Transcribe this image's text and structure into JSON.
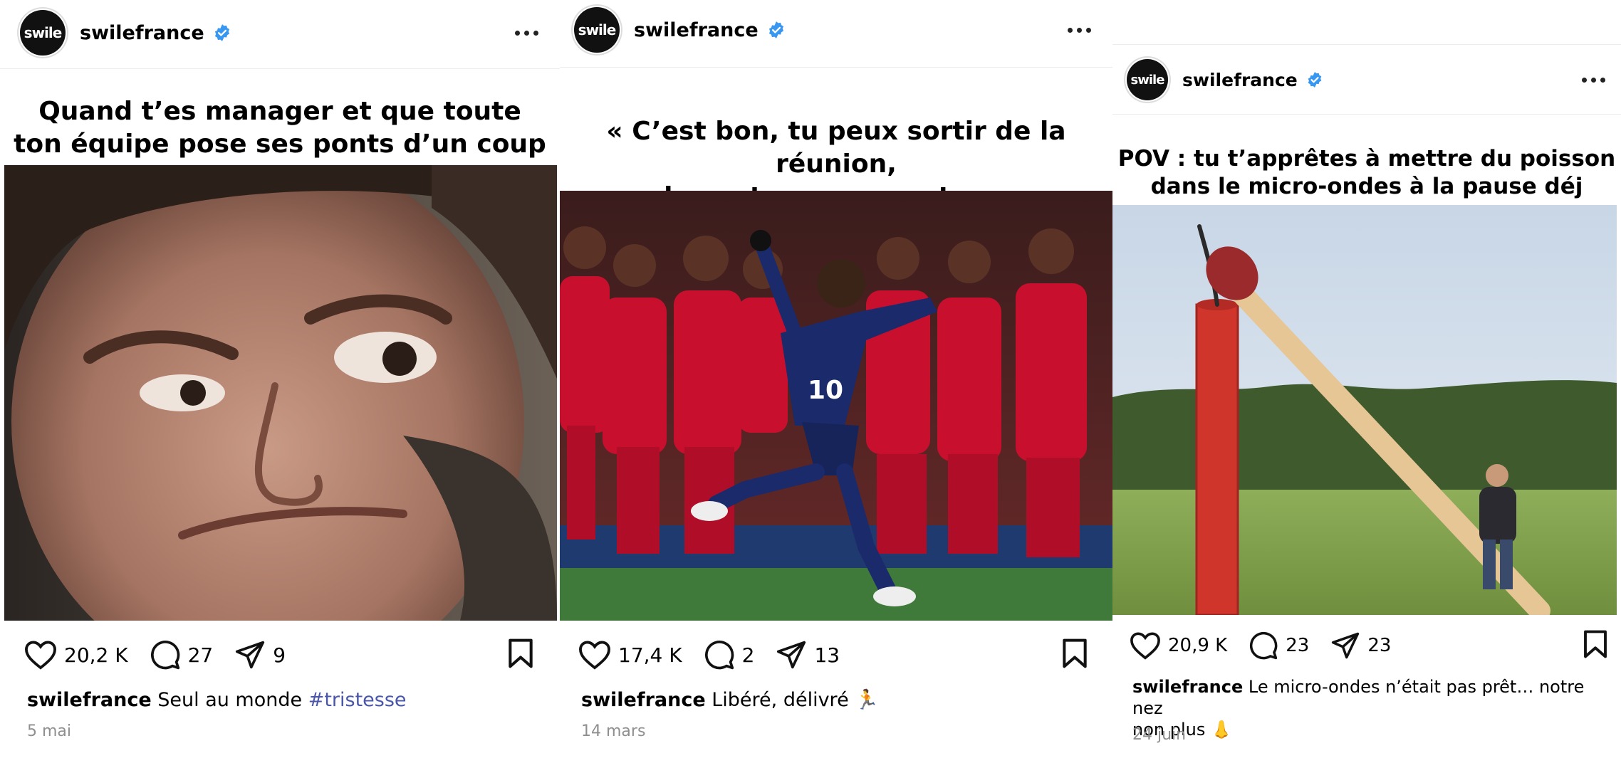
{
  "posts": [
    {
      "username": "swilefrance",
      "avatar_text": "swile",
      "overlay_title_line1": "Quand t’es manager et que toute",
      "overlay_title_line2": "ton équipe pose ses ponts d’un coup",
      "likes": "20,2 K",
      "comments": "27",
      "shares": "9",
      "caption_user": "swilefrance",
      "caption_text": "Seul au monde",
      "caption_hashtag": "#tristesse",
      "date": "5 mai"
    },
    {
      "username": "swilefrance",
      "avatar_text": "swile",
      "overlay_title_line1": "« C’est bon, tu peux sortir de la réunion,",
      "overlay_title_line2": "les autres vous restez »",
      "likes": "17,4 K",
      "comments": "2",
      "shares": "13",
      "caption_user": "swilefrance",
      "caption_text": "Libéré, délivré 🏃",
      "date": "14 mars",
      "jersey_number": "10"
    },
    {
      "username": "swilefrance",
      "avatar_text": "swile",
      "overlay_title_line1": "POV : tu t’apprêtes à mettre du poisson",
      "overlay_title_line2": "dans le micro-ondes à la pause déj",
      "likes": "20,9 K",
      "comments": "23",
      "shares": "23",
      "caption_user": "swilefrance",
      "caption_text": "Le micro-ondes n’était pas prêt… notre nez",
      "caption_text_line2": "non plus 👃",
      "date": "24 juin"
    }
  ],
  "colors": {
    "verified": "#3897f0",
    "hashtag": "#4a56a8",
    "date": "#8e8e8e",
    "kit_red": "#c8102e",
    "kit_navy": "#1b2a6b"
  },
  "icons": [
    "heart-icon",
    "comment-icon",
    "share-icon",
    "bookmark-icon",
    "more-icon",
    "verified-badge-icon"
  ]
}
